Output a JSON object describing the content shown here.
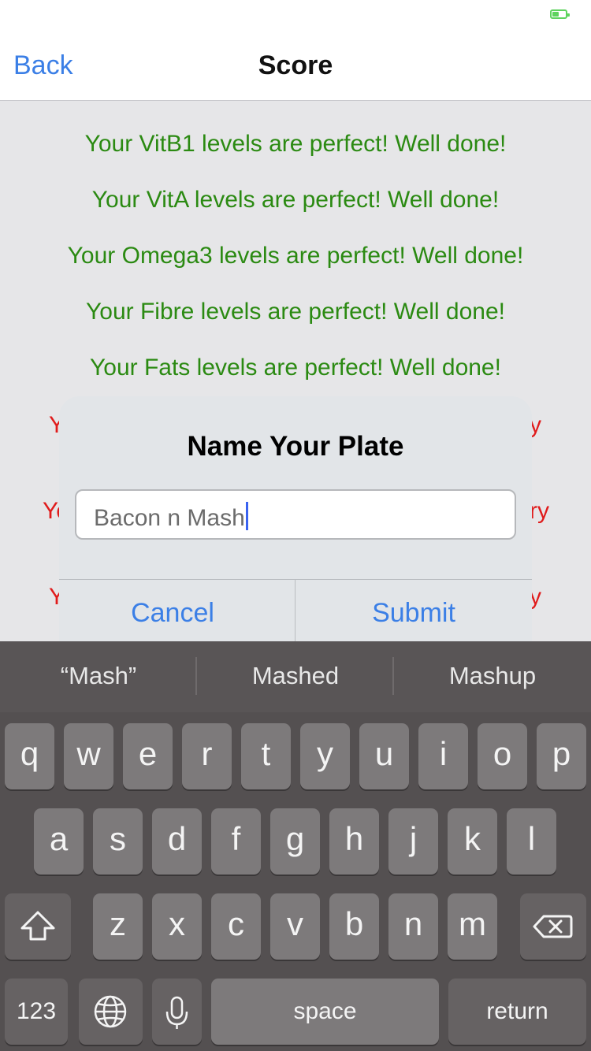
{
  "nav": {
    "back_label": "Back",
    "title": "Score"
  },
  "messages": [
    {
      "text": "Your VitB1 levels are perfect! Well done!",
      "status": "good"
    },
    {
      "text": "Your VitA levels are perfect! Well done!",
      "status": "good"
    },
    {
      "text": "Your Omega3 levels are perfect! Well done!",
      "status": "good"
    },
    {
      "text": "Your Fibre levels are perfect! Well done!",
      "status": "good"
    },
    {
      "text": "Your Fats levels are perfect! Well done!",
      "status": "good"
    }
  ],
  "partially_hidden_messages": [
    {
      "left": "Y",
      "right": "y"
    },
    {
      "left": "Yo",
      "right": "ry"
    },
    {
      "left": "Y",
      "right": "y"
    }
  ],
  "alert": {
    "title": "Name Your Plate",
    "input_value": "Bacon n Mash",
    "cancel_label": "Cancel",
    "submit_label": "Submit"
  },
  "keyboard": {
    "suggestions": [
      "“Mash”",
      "Mashed",
      "Mashup"
    ],
    "row1": [
      "q",
      "w",
      "e",
      "r",
      "t",
      "y",
      "u",
      "i",
      "o",
      "p"
    ],
    "row2": [
      "a",
      "s",
      "d",
      "f",
      "g",
      "h",
      "j",
      "k",
      "l"
    ],
    "row3": [
      "z",
      "x",
      "c",
      "v",
      "b",
      "n",
      "m"
    ],
    "numbers_label": "123",
    "space_label": "space",
    "return_label": "return",
    "shift_icon": "shift-icon",
    "delete_icon": "delete-icon",
    "globe_icon": "globe-icon",
    "mic_icon": "microphone-icon"
  },
  "colors": {
    "accent": "#3b7fe6",
    "good": "#2b8a12",
    "bad": "#e01b1b",
    "battery": "#5ed35e"
  }
}
